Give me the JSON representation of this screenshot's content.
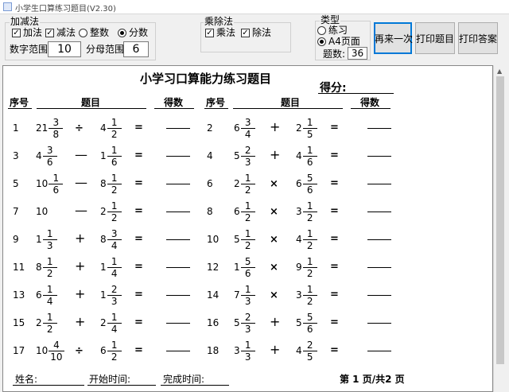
{
  "window": {
    "title": "小学生口算练习题目(V2.30)"
  },
  "controls": {
    "addsub": {
      "group_label": "加减法",
      "add_label": "加法",
      "add_checked": true,
      "sub_label": "减法",
      "sub_checked": true,
      "integer_label": "整数",
      "integer_selected": false,
      "fraction_label": "分数",
      "fraction_selected": true,
      "num_range_label": "数字范围:",
      "num_range_value": "10",
      "den_range_label": "分母范围:",
      "den_range_value": "6"
    },
    "muldiv": {
      "group_label": "乘除法",
      "mul_label": "乘法",
      "mul_checked": true,
      "div_label": "除法",
      "div_checked": true
    },
    "type": {
      "group_label": "类型",
      "practice_label": "练习",
      "practice_selected": false,
      "a4_label": "A4页面",
      "a4_selected": true,
      "count_label": "题数:",
      "count_value": "36"
    },
    "buttons": {
      "again": "再来一次",
      "print_questions": "打印题目",
      "print_answers": "打印答案"
    }
  },
  "sheet": {
    "title": "小学习口算能力练习题目",
    "score_label": "得分:",
    "headers": {
      "no": "序号",
      "question": "题目",
      "score": "得数"
    },
    "footer": {
      "name_label": "姓名:",
      "start_label": "开始时间:",
      "end_label": "完成时间:",
      "page_label": "第 1 页/共2 页"
    }
  },
  "questions_left": [
    {
      "no": "1",
      "a": {
        "w": "21",
        "n": "3",
        "d": "8"
      },
      "op": "÷",
      "b": {
        "w": "4",
        "n": "1",
        "d": "2"
      }
    },
    {
      "no": "3",
      "a": {
        "w": "4",
        "n": "3",
        "d": "6"
      },
      "op": "—",
      "b": {
        "w": "1",
        "n": "1",
        "d": "6"
      }
    },
    {
      "no": "5",
      "a": {
        "w": "10",
        "n": "1",
        "d": "6"
      },
      "op": "—",
      "b": {
        "w": "8",
        "n": "1",
        "d": "2"
      }
    },
    {
      "no": "7",
      "a": {
        "w": "10",
        "n": "",
        "d": ""
      },
      "op": "—",
      "b": {
        "w": "2",
        "n": "1",
        "d": "2"
      }
    },
    {
      "no": "9",
      "a": {
        "w": "1",
        "n": "1",
        "d": "3"
      },
      "op": "+",
      "b": {
        "w": "8",
        "n": "3",
        "d": "4"
      }
    },
    {
      "no": "11",
      "a": {
        "w": "8",
        "n": "1",
        "d": "2"
      },
      "op": "+",
      "b": {
        "w": "1",
        "n": "1",
        "d": "4"
      }
    },
    {
      "no": "13",
      "a": {
        "w": "6",
        "n": "1",
        "d": "4"
      },
      "op": "+",
      "b": {
        "w": "1",
        "n": "2",
        "d": "3"
      }
    },
    {
      "no": "15",
      "a": {
        "w": "2",
        "n": "1",
        "d": "2"
      },
      "op": "+",
      "b": {
        "w": "2",
        "n": "1",
        "d": "4"
      }
    },
    {
      "no": "17",
      "a": {
        "w": "10",
        "n": "4",
        "d": "10"
      },
      "op": "÷",
      "b": {
        "w": "6",
        "n": "1",
        "d": "2"
      }
    }
  ],
  "questions_right": [
    {
      "no": "2",
      "a": {
        "w": "6",
        "n": "3",
        "d": "4"
      },
      "op": "+",
      "b": {
        "w": "2",
        "n": "1",
        "d": "5"
      }
    },
    {
      "no": "4",
      "a": {
        "w": "5",
        "n": "2",
        "d": "3"
      },
      "op": "+",
      "b": {
        "w": "4",
        "n": "1",
        "d": "6"
      }
    },
    {
      "no": "6",
      "a": {
        "w": "2",
        "n": "1",
        "d": "2"
      },
      "op": "×",
      "b": {
        "w": "6",
        "n": "5",
        "d": "6"
      }
    },
    {
      "no": "8",
      "a": {
        "w": "6",
        "n": "1",
        "d": "2"
      },
      "op": "×",
      "b": {
        "w": "3",
        "n": "1",
        "d": "2"
      }
    },
    {
      "no": "10",
      "a": {
        "w": "5",
        "n": "1",
        "d": "2"
      },
      "op": "×",
      "b": {
        "w": "4",
        "n": "1",
        "d": "2"
      }
    },
    {
      "no": "12",
      "a": {
        "w": "1",
        "n": "5",
        "d": "6"
      },
      "op": "×",
      "b": {
        "w": "9",
        "n": "1",
        "d": "2"
      }
    },
    {
      "no": "14",
      "a": {
        "w": "7",
        "n": "1",
        "d": "3"
      },
      "op": "×",
      "b": {
        "w": "3",
        "n": "1",
        "d": "2"
      }
    },
    {
      "no": "16",
      "a": {
        "w": "5",
        "n": "2",
        "d": "3"
      },
      "op": "+",
      "b": {
        "w": "5",
        "n": "5",
        "d": "6"
      }
    },
    {
      "no": "18",
      "a": {
        "w": "3",
        "n": "1",
        "d": "3"
      },
      "op": "+",
      "b": {
        "w": "4",
        "n": "2",
        "d": "5"
      }
    }
  ],
  "equals_sign": "="
}
